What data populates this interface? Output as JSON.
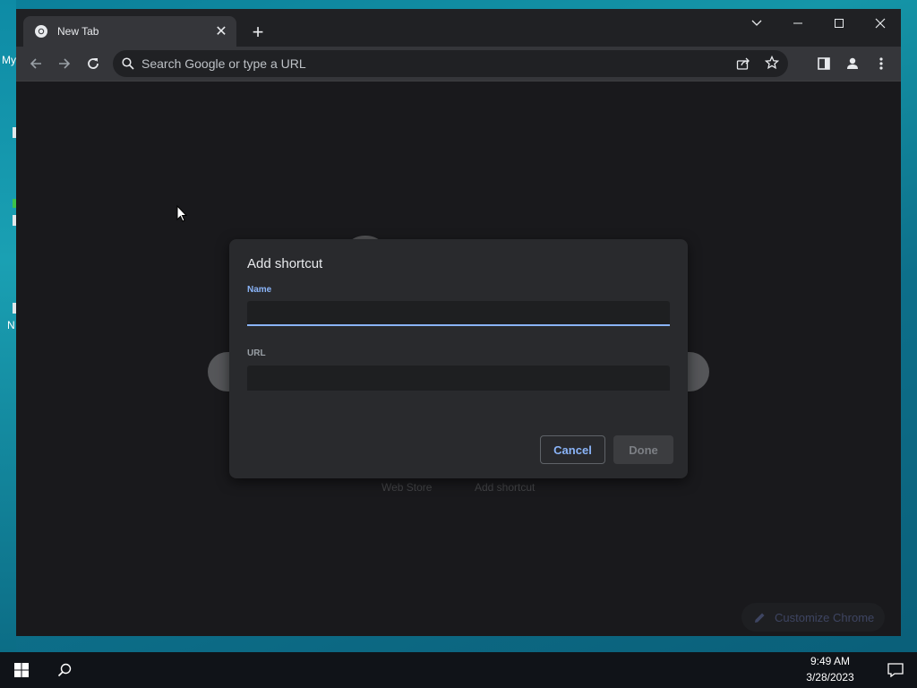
{
  "desktop": {
    "icon_labels": [
      "My",
      "N"
    ]
  },
  "browser": {
    "tab": {
      "title": "New Tab",
      "favicon": "chrome-icon"
    },
    "new_tab_symbol": "+",
    "omnibox": {
      "placeholder": "Search Google or type a URL",
      "value": ""
    },
    "window_controls": [
      "chevron-down-icon",
      "minimize-icon",
      "maximize-icon",
      "close-icon"
    ],
    "toolbar_icons": [
      "back-arrow-icon",
      "forward-arrow-icon",
      "reload-icon",
      "share-icon",
      "star-icon",
      "side-panel-icon",
      "profile-icon",
      "kebab-menu-icon"
    ]
  },
  "new_tab_page": {
    "shortcut_labels": [
      "Web Store",
      "Add shortcut"
    ],
    "customize_label": "Customize Chrome"
  },
  "dialog": {
    "title": "Add shortcut",
    "name_label": "Name",
    "name_value": "",
    "url_label": "URL",
    "url_value": "",
    "cancel_label": "Cancel",
    "done_label": "Done"
  },
  "taskbar": {
    "time": "9:49 AM",
    "date": "3/28/2023"
  },
  "colors": {
    "accent": "#8ab4f8",
    "browser_bg": "#202124",
    "toolbar_bg": "#35363a",
    "dialog_bg": "#292a2d",
    "taskbar_bg": "#101318"
  }
}
